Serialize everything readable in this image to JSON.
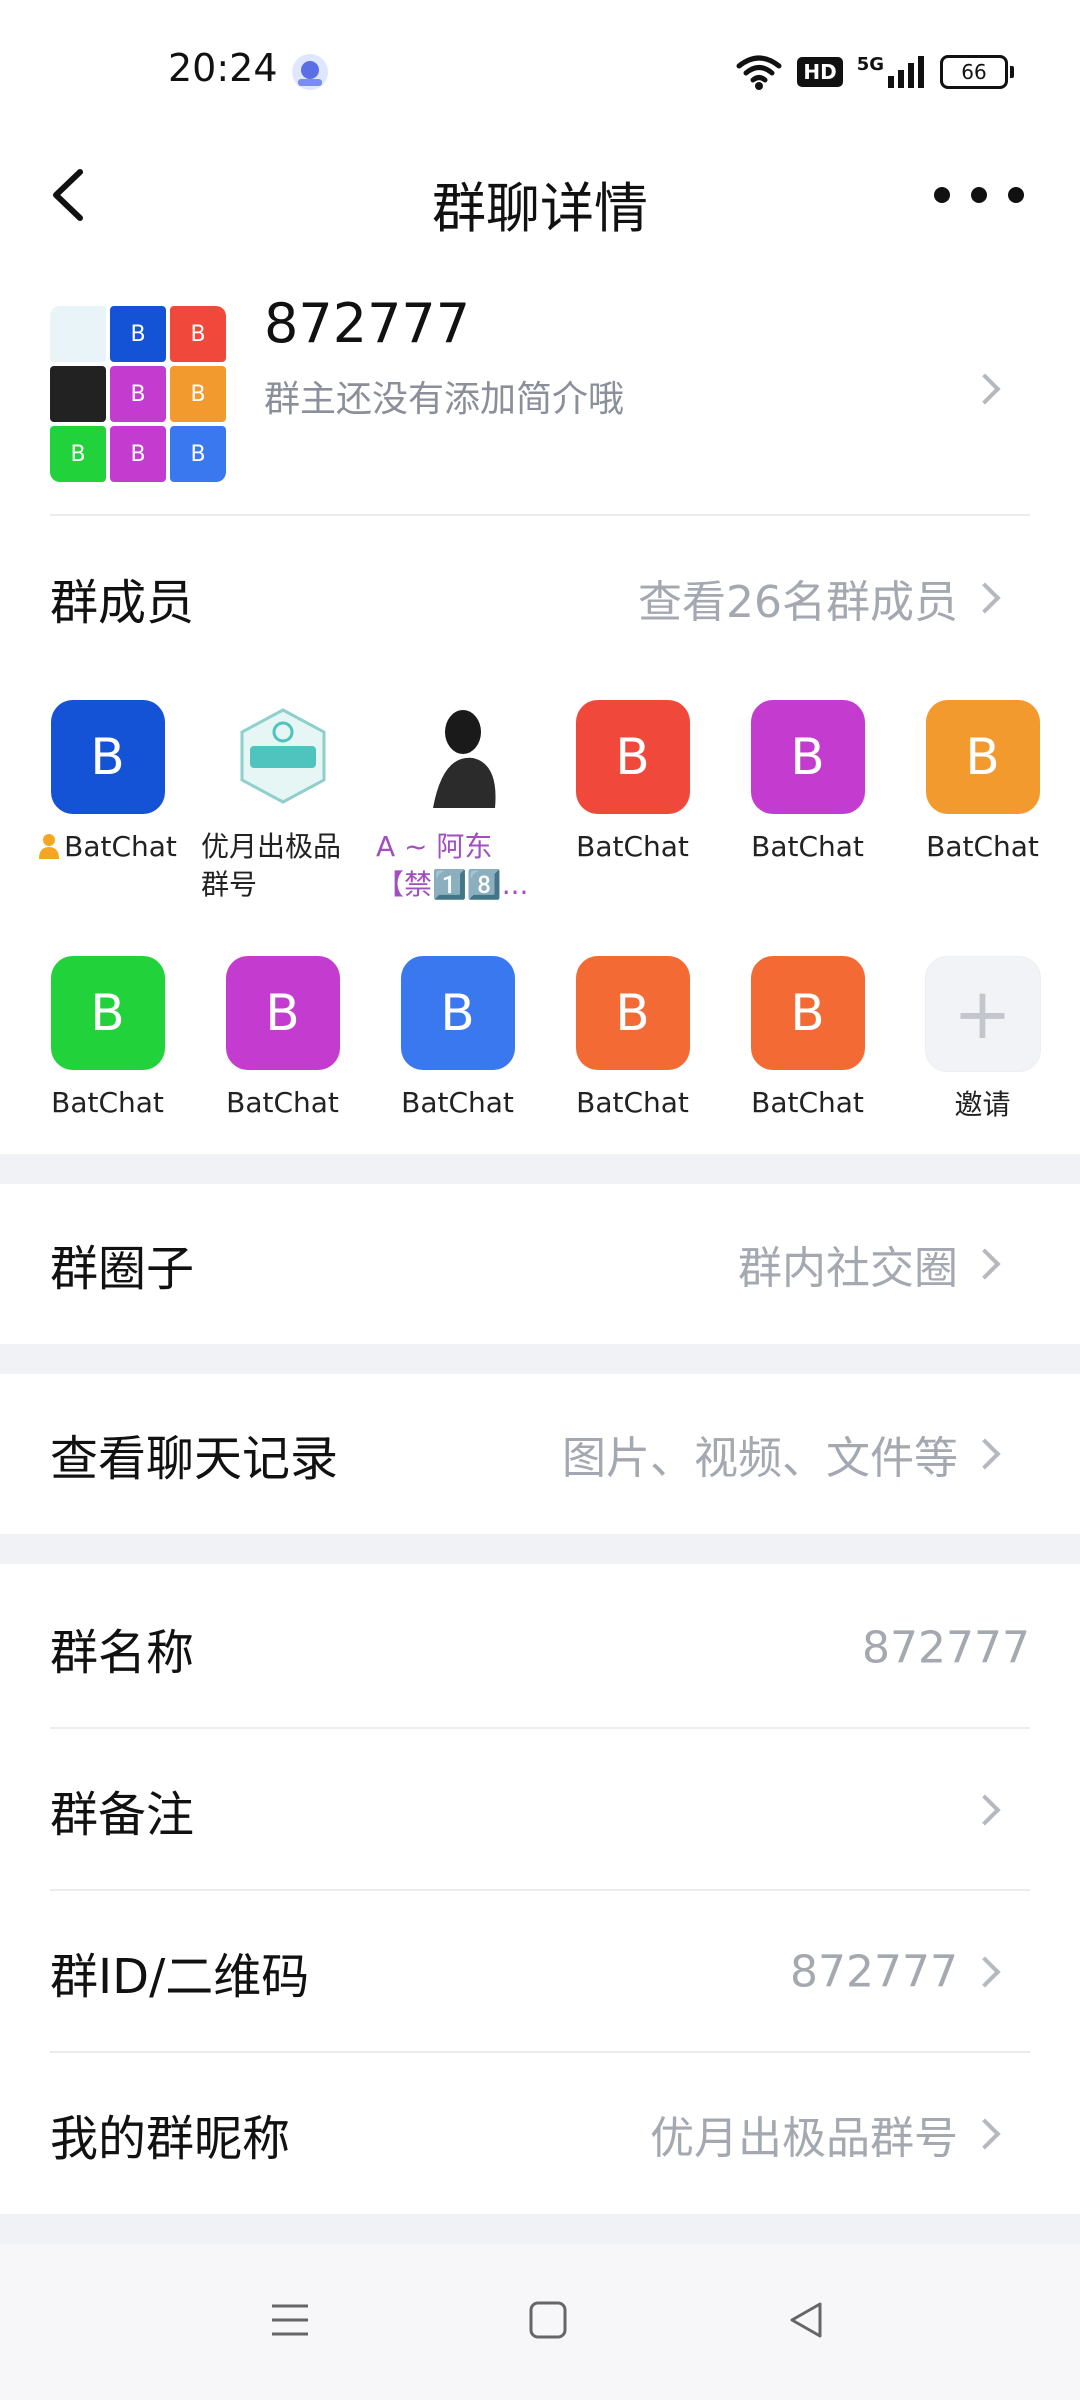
{
  "status_bar": {
    "time": "20:24",
    "hd_label": "HD",
    "network_label": "5G",
    "battery_level": "66"
  },
  "header": {
    "title": "群聊详情"
  },
  "group": {
    "name": "872777",
    "intro": "群主还没有添加简介哦",
    "avatar_tiles": [
      {
        "label": "",
        "color": "#e8f4f8"
      },
      {
        "label": "B",
        "color": "#1452d6"
      },
      {
        "label": "B",
        "color": "#f0483a"
      },
      {
        "label": "",
        "color": "#222222"
      },
      {
        "label": "B",
        "color": "#c33ccf"
      },
      {
        "label": "B",
        "color": "#f29a2e"
      },
      {
        "label": "B",
        "color": "#22d23a"
      },
      {
        "label": "B",
        "color": "#c33ccf"
      },
      {
        "label": "B",
        "color": "#3a78f0"
      }
    ]
  },
  "members": {
    "label": "群成员",
    "view_all": "查看26名群成员",
    "list": [
      {
        "avatar_text": "B",
        "name": "BatChat",
        "color": "#1452d6",
        "owner": true
      },
      {
        "avatar_text": "",
        "name": "优月出极品群号",
        "color": "#ffffff",
        "badge": "QQ 勋章墙"
      },
      {
        "avatar_text": "",
        "name": "A ~ 阿东 【禁1️⃣8️⃣...",
        "color": "#ffffff",
        "photo": true
      },
      {
        "avatar_text": "B",
        "name": "BatChat",
        "color": "#f0483a"
      },
      {
        "avatar_text": "B",
        "name": "BatChat",
        "color": "#c33ccf"
      },
      {
        "avatar_text": "B",
        "name": "BatChat",
        "color": "#f29a2e"
      },
      {
        "avatar_text": "B",
        "name": "BatChat",
        "color": "#22d23a"
      },
      {
        "avatar_text": "B",
        "name": "BatChat",
        "color": "#c33ccf"
      },
      {
        "avatar_text": "B",
        "name": "BatChat",
        "color": "#3a78f0"
      },
      {
        "avatar_text": "B",
        "name": "BatChat",
        "color": "#f46a35"
      },
      {
        "avatar_text": "B",
        "name": "BatChat",
        "color": "#f46a35"
      },
      {
        "avatar_text": "+",
        "name": "邀请",
        "color": "#f2f3f6",
        "invite": true
      }
    ]
  },
  "rows": {
    "circle": {
      "label": "群圈子",
      "value": "群内社交圈"
    },
    "history": {
      "label": "查看聊天记录",
      "value": "图片、视频、文件等"
    },
    "group_name": {
      "label": "群名称",
      "value": "872777"
    },
    "remark": {
      "label": "群备注",
      "value": ""
    },
    "group_id": {
      "label": "群ID/二维码",
      "value": "872777"
    },
    "nickname": {
      "label": "我的群昵称",
      "value": "优月出极品群号"
    }
  },
  "colors": {
    "accent_gray": "#a4a8b0",
    "band": "#f1f2f5"
  }
}
